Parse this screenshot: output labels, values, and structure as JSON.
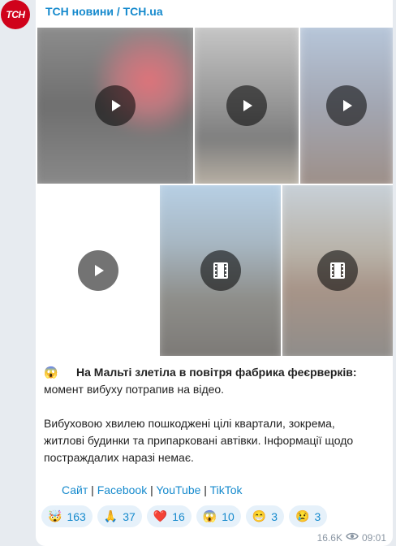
{
  "channel": {
    "avatar_text": "ТСН",
    "name": "ТСН новини / TCH.ua"
  },
  "post": {
    "headline_emoji": "😱",
    "headline_bold": "На Мальті злетіла в повітря фабрика феєрверків:",
    "headline_rest": "момент вибуху потрапив на відео.",
    "body_line1": "Вибуховою хвилею пошкоджені цілі квартали, зокрема,",
    "body_line2": "житлові будинки та припарковані автівки. Інформації щодо",
    "body_line3": "постраждалих наразі немає."
  },
  "links": {
    "site": "Сайт",
    "sep1": " | ",
    "facebook": "Facebook",
    "sep2": " | ",
    "youtube": "YouTube",
    "sep3": " | ",
    "tiktok": "TikTok"
  },
  "reactions": [
    {
      "icon": "🤯",
      "count": "163"
    },
    {
      "icon": "🙏",
      "count": "37"
    },
    {
      "icon": "❤️",
      "count": "16"
    },
    {
      "icon": "😱",
      "count": "10"
    },
    {
      "icon": "😁",
      "count": "3"
    },
    {
      "icon": "😢",
      "count": "3"
    }
  ],
  "meta": {
    "views": "16.6K",
    "time": "09:01"
  }
}
